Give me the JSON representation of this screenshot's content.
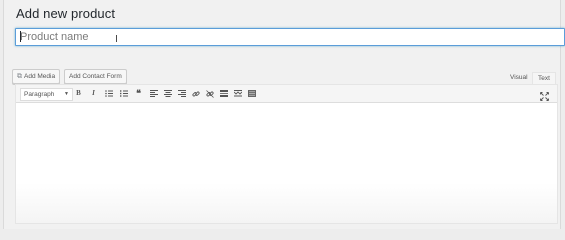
{
  "page": {
    "title": "Add new product"
  },
  "title_field": {
    "placeholder": "Product name",
    "value": ""
  },
  "media_buttons": {
    "add_media": "Add Media",
    "add_contact_form": "Add Contact Form"
  },
  "editor_tabs": {
    "visual": "Visual",
    "text": "Text",
    "active": "visual"
  },
  "toolbar": {
    "format_select": "Paragraph",
    "buttons": [
      "bold-icon",
      "italic-icon",
      "bullet-list-icon",
      "numbered-list-icon",
      "blockquote-icon",
      "align-left-icon",
      "align-center-icon",
      "align-right-icon",
      "link-icon",
      "unlink-icon",
      "read-more-icon",
      "toolbar-toggle-icon",
      "kitchen-sink-icon",
      "fullscreen-icon"
    ]
  },
  "colors": {
    "focus_border": "#5b9dd9",
    "background": "#f1f1f1",
    "text": "#23282d"
  }
}
